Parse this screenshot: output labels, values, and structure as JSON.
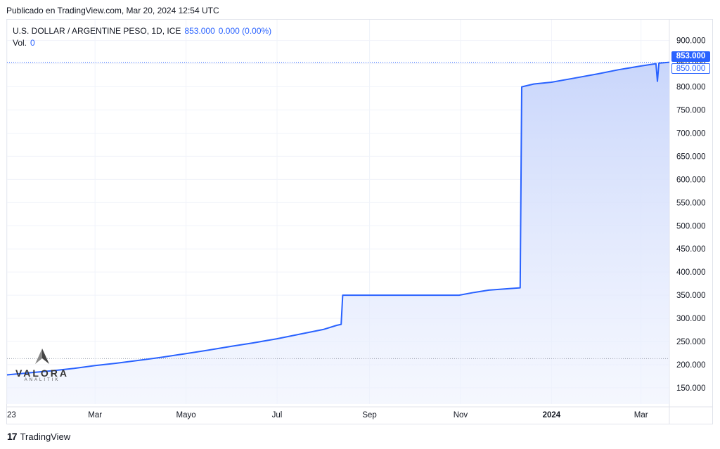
{
  "header": {
    "published": "Publicado en TradingView.com, Mar 20, 2024 12:54 UTC"
  },
  "legend": {
    "symbol": "U.S. DOLLAR / ARGENTINE PESO, 1D, ICE",
    "last": "853.000",
    "change": "0.000 (0.00%)",
    "vol_label": "Vol.",
    "vol_value": "0"
  },
  "tags": {
    "last_price": "853.000",
    "prev_price": "850.000"
  },
  "watermark": {
    "name": "VALORA",
    "sub": "ANALITIK"
  },
  "footer": {
    "brand": "TradingView",
    "logo_glyph": "17"
  },
  "colors": {
    "line": "#2962ff",
    "area_top": "#c9d6fb",
    "grid": "#f0f3fa",
    "axis_text": "#131722"
  },
  "chart_data": {
    "type": "area",
    "title": "",
    "xlabel": "",
    "ylabel": "",
    "x_range": [
      "2023-01-01",
      "2024-03-20"
    ],
    "ylim": [
      115,
      945
    ],
    "y_ticks": [
      150,
      200,
      250,
      300,
      350,
      400,
      450,
      500,
      550,
      600,
      650,
      700,
      750,
      800,
      850,
      900
    ],
    "y_tick_labels": [
      "150.000",
      "200.000",
      "250.000",
      "300.000",
      "350.000",
      "400.000",
      "450.000",
      "500.000",
      "550.000",
      "600.000",
      "650.000",
      "700.000",
      "750.000",
      "800.000",
      "850.000",
      "900.000"
    ],
    "x_ticks": [
      {
        "date": "2023-01-01",
        "label": "23"
      },
      {
        "date": "2023-03-01",
        "label": "Mar"
      },
      {
        "date": "2023-05-01",
        "label": "Mayo"
      },
      {
        "date": "2023-07-01",
        "label": "Jul"
      },
      {
        "date": "2023-09-01",
        "label": "Sep"
      },
      {
        "date": "2023-11-01",
        "label": "Nov"
      },
      {
        "date": "2024-01-01",
        "label": "2024"
      },
      {
        "date": "2024-03-01",
        "label": "Mar"
      }
    ],
    "grid": true,
    "series": [
      {
        "points": [
          [
            "2023-01-01",
            178
          ],
          [
            "2023-01-15",
            182
          ],
          [
            "2023-02-01",
            187
          ],
          [
            "2023-02-15",
            192
          ],
          [
            "2023-03-01",
            198
          ],
          [
            "2023-03-15",
            203
          ],
          [
            "2023-04-01",
            210
          ],
          [
            "2023-04-15",
            216
          ],
          [
            "2023-05-01",
            224
          ],
          [
            "2023-05-15",
            231
          ],
          [
            "2023-06-01",
            240
          ],
          [
            "2023-06-15",
            247
          ],
          [
            "2023-07-01",
            256
          ],
          [
            "2023-07-15",
            265
          ],
          [
            "2023-08-01",
            276
          ],
          [
            "2023-08-10",
            285
          ],
          [
            "2023-08-13",
            287
          ],
          [
            "2023-08-14",
            350
          ],
          [
            "2023-09-01",
            350
          ],
          [
            "2023-10-01",
            350
          ],
          [
            "2023-10-31",
            350
          ],
          [
            "2023-11-10",
            356
          ],
          [
            "2023-11-20",
            361
          ],
          [
            "2023-12-11",
            366
          ],
          [
            "2023-12-12",
            800
          ],
          [
            "2023-12-20",
            806
          ],
          [
            "2024-01-01",
            810
          ],
          [
            "2024-01-15",
            818
          ],
          [
            "2024-02-01",
            828
          ],
          [
            "2024-02-15",
            837
          ],
          [
            "2024-03-01",
            845
          ],
          [
            "2024-03-11",
            850
          ],
          [
            "2024-03-12",
            812
          ],
          [
            "2024-03-13",
            851
          ],
          [
            "2024-03-20",
            853
          ]
        ]
      }
    ],
    "reference_lines": {
      "last_price": 853,
      "horizontal_dotted": 213
    }
  }
}
